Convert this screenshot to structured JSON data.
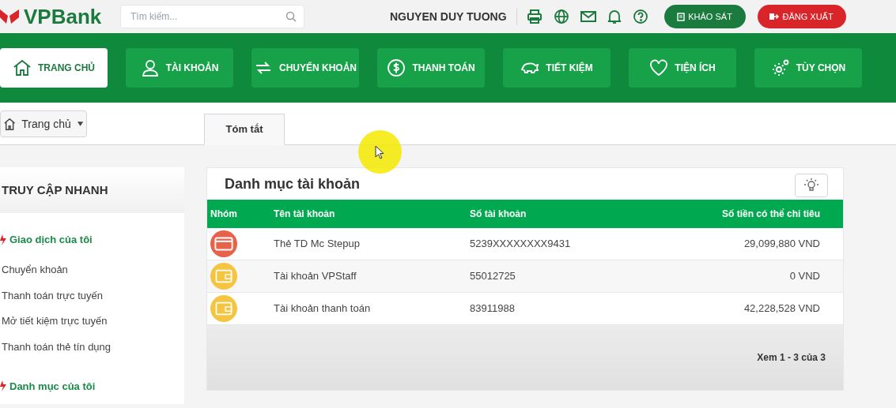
{
  "header": {
    "logo": "VPBank",
    "search": {
      "placeholder": "Tìm kiếm..."
    },
    "user_name": "NGUYEN DUY TUONG",
    "buttons": [
      {
        "label": "KHẢO SÁT",
        "color": "#1b7a3e"
      },
      {
        "label": "ĐĂNG XUẤT",
        "color": "#d9252a"
      }
    ]
  },
  "nav": [
    {
      "label": "TRANG CHỦ",
      "selected": true
    },
    {
      "label": "TÀI KHOẢN",
      "selected": false
    },
    {
      "label": "CHUYỂN KHOẢN",
      "selected": false
    },
    {
      "label": "THANH TOÁN",
      "selected": false
    },
    {
      "label": "TIẾT KIỆM",
      "selected": false
    },
    {
      "label": "TIỆN ÍCH",
      "selected": false
    },
    {
      "label": "TÙY CHỌN",
      "selected": false
    }
  ],
  "breadcrumb": "Trang chủ",
  "tabs": [
    {
      "label": "Tóm tắt",
      "selected": true
    }
  ],
  "sidebar": {
    "title": "TRUY CẬP NHANH",
    "sections": [
      {
        "title": "Giao dịch của tôi",
        "items": [
          "Chuyển khoản",
          "Thanh toán trực tuyến",
          "Mở tiết kiệm trực tuyến",
          "Thanh toán thẻ tín dụng"
        ]
      },
      {
        "title": "Danh mục của tôi"
      }
    ]
  },
  "accounts": {
    "title": "Danh mục tài khoản",
    "columns": [
      "Nhóm",
      "Tên tài khoản",
      "Số tài khoản",
      "Số tiền có thể chi tiêu"
    ],
    "rows": [
      {
        "kind": "card",
        "color": "#e8624a",
        "name": "Thẻ TD Mc Stepup",
        "number": "5239XXXXXXXX9431",
        "amount": "29,099,880 VND"
      },
      {
        "kind": "wallet",
        "color": "#f5c542",
        "name": "Tài khoản VPStaff",
        "number": "55012725",
        "amount": "0 VND"
      },
      {
        "kind": "wallet",
        "color": "#f5c542",
        "name": "Tài khoản thanh toán",
        "number": "83911988",
        "amount": "42,228,528 VND"
      }
    ],
    "pager": "Xem 1 - 3 của 3"
  }
}
